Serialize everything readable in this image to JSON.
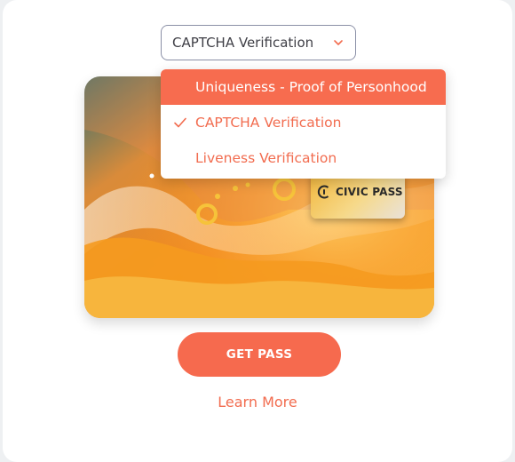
{
  "selector": {
    "selected_label": "CAPTCHA Verification",
    "options": [
      {
        "label": "Uniqueness - Proof of Personhood",
        "highlighted": true,
        "selected": false
      },
      {
        "label": "CAPTCHA Verification",
        "highlighted": false,
        "selected": true
      },
      {
        "label": "Liveness Verification",
        "highlighted": false,
        "selected": false
      }
    ]
  },
  "pass_card": {
    "brand_label": "CIVIC PASS"
  },
  "actions": {
    "get_pass_label": "GET PASS",
    "learn_more_label": "Learn More"
  },
  "colors": {
    "accent": "#f66a4e",
    "menu_highlight": "#f76c4f",
    "select_border": "#8a8fa6"
  },
  "icons": {
    "dropdown": "chevron-down-icon",
    "selected_option": "check-icon",
    "brand": "civic-logo-icon"
  }
}
